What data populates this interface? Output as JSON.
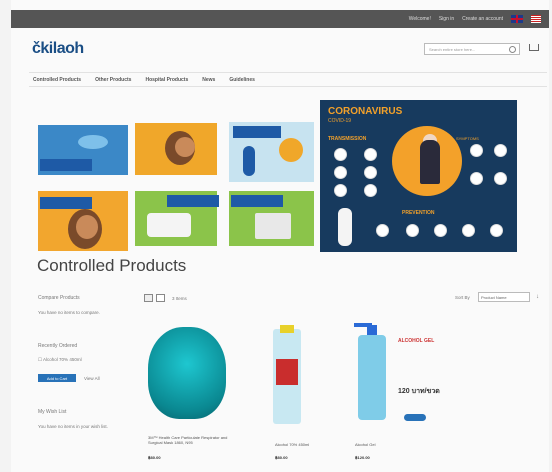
{
  "topbar": {
    "welcome": "Welcome!",
    "links": [
      "Sign in",
      "Create an account"
    ]
  },
  "header": {
    "logo": "čkilaoh",
    "search_placeholder": "Search entire store here..."
  },
  "nav": {
    "items": [
      "Controlled Products",
      "Other Products",
      "Hospital Products",
      "News",
      "Guidelines"
    ]
  },
  "banner": {
    "poster_title": "CORONAVIRUS",
    "poster_subtitle": "COVID-19",
    "poster_transmission": "TRANSMISSION",
    "poster_prevention": "PREVENTION",
    "poster_symptoms": "SYMPTOMS"
  },
  "page": {
    "title": "Controlled Products"
  },
  "sidebar": {
    "compare_title": "Compare Products",
    "compare_empty": "You have no items to compare.",
    "ordered_title": "Recently Ordered",
    "ordered_item": "Alcohol 70% 450ml",
    "add_to_cart": "Add to Cart",
    "view_all": "View All",
    "wishlist_title": "My Wish List",
    "wishlist_empty": "You have no items in your wish list."
  },
  "toolbar": {
    "count": "3 Items",
    "sort_label": "Sort By",
    "sort_value": "Product Name"
  },
  "promo": {
    "line1": "ALCOHOL GEL",
    "price_big": "120 บาท/ขวด"
  },
  "products": [
    {
      "name": "3M™ Health Care Particulate Respirator and Surgical Mask 1860, N95",
      "price": "฿80.00"
    },
    {
      "name": "Alcohol 70% 450ml",
      "price": "฿80.00"
    },
    {
      "name": "Alcohol Gel",
      "price": "฿120.00"
    }
  ],
  "colors": {
    "accent": "#2872b8",
    "topbar": "#555555",
    "poster_bg": "#173a5e",
    "poster_accent": "#f3a12a"
  }
}
